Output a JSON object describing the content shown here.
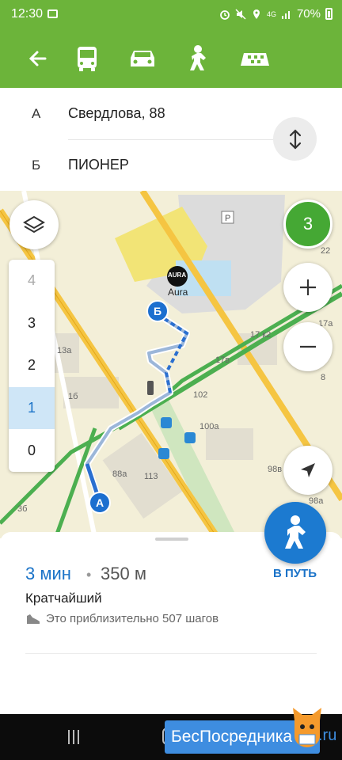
{
  "status_bar": {
    "time": "12:30",
    "signal": "4G",
    "battery": "70%"
  },
  "colors": {
    "brand_green": "#6cb43a",
    "accent_blue": "#1b73c8",
    "route_blue": "#2a6fd0",
    "floors_green": "#45a834"
  },
  "toolbar": {
    "icons": [
      "back-arrow-icon",
      "bus-icon",
      "car-icon",
      "pedestrian-icon",
      "taxi-icon"
    ],
    "active": "pedestrian-icon"
  },
  "route": {
    "from_letter": "А",
    "from": "Свердлова, 88",
    "to_letter": "Б",
    "to": "ПИОНЕР"
  },
  "map": {
    "floors_count": "3",
    "floors": [
      "4",
      "3",
      "2",
      "1",
      "0"
    ],
    "active_floor": "1",
    "disabled_floor": "4",
    "mall_logo": "AURA",
    "mall_name": "Aura",
    "marker_a": "А",
    "marker_b": "Б",
    "labels": {
      "l22": "22",
      "l17k2": "17 к2",
      "l17b": "17в",
      "l102": "102",
      "l100a": "100а",
      "l13a": "13а",
      "l1b": "1б",
      "l88a": "88а",
      "l113": "113",
      "l98b": "98в",
      "l98a": "98а",
      "l3b": "3б",
      "l17a": "17а",
      "l8": "8"
    }
  },
  "summary": {
    "duration": "3 мин",
    "separator": "•",
    "distance": "350 м",
    "go_label": "В ПУТЬ",
    "route_type": "Кратчайший",
    "steps_text": "Это приблизительно 507 шагов"
  },
  "watermark": {
    "text": "БесПосредника",
    "suffix": ".ru"
  }
}
